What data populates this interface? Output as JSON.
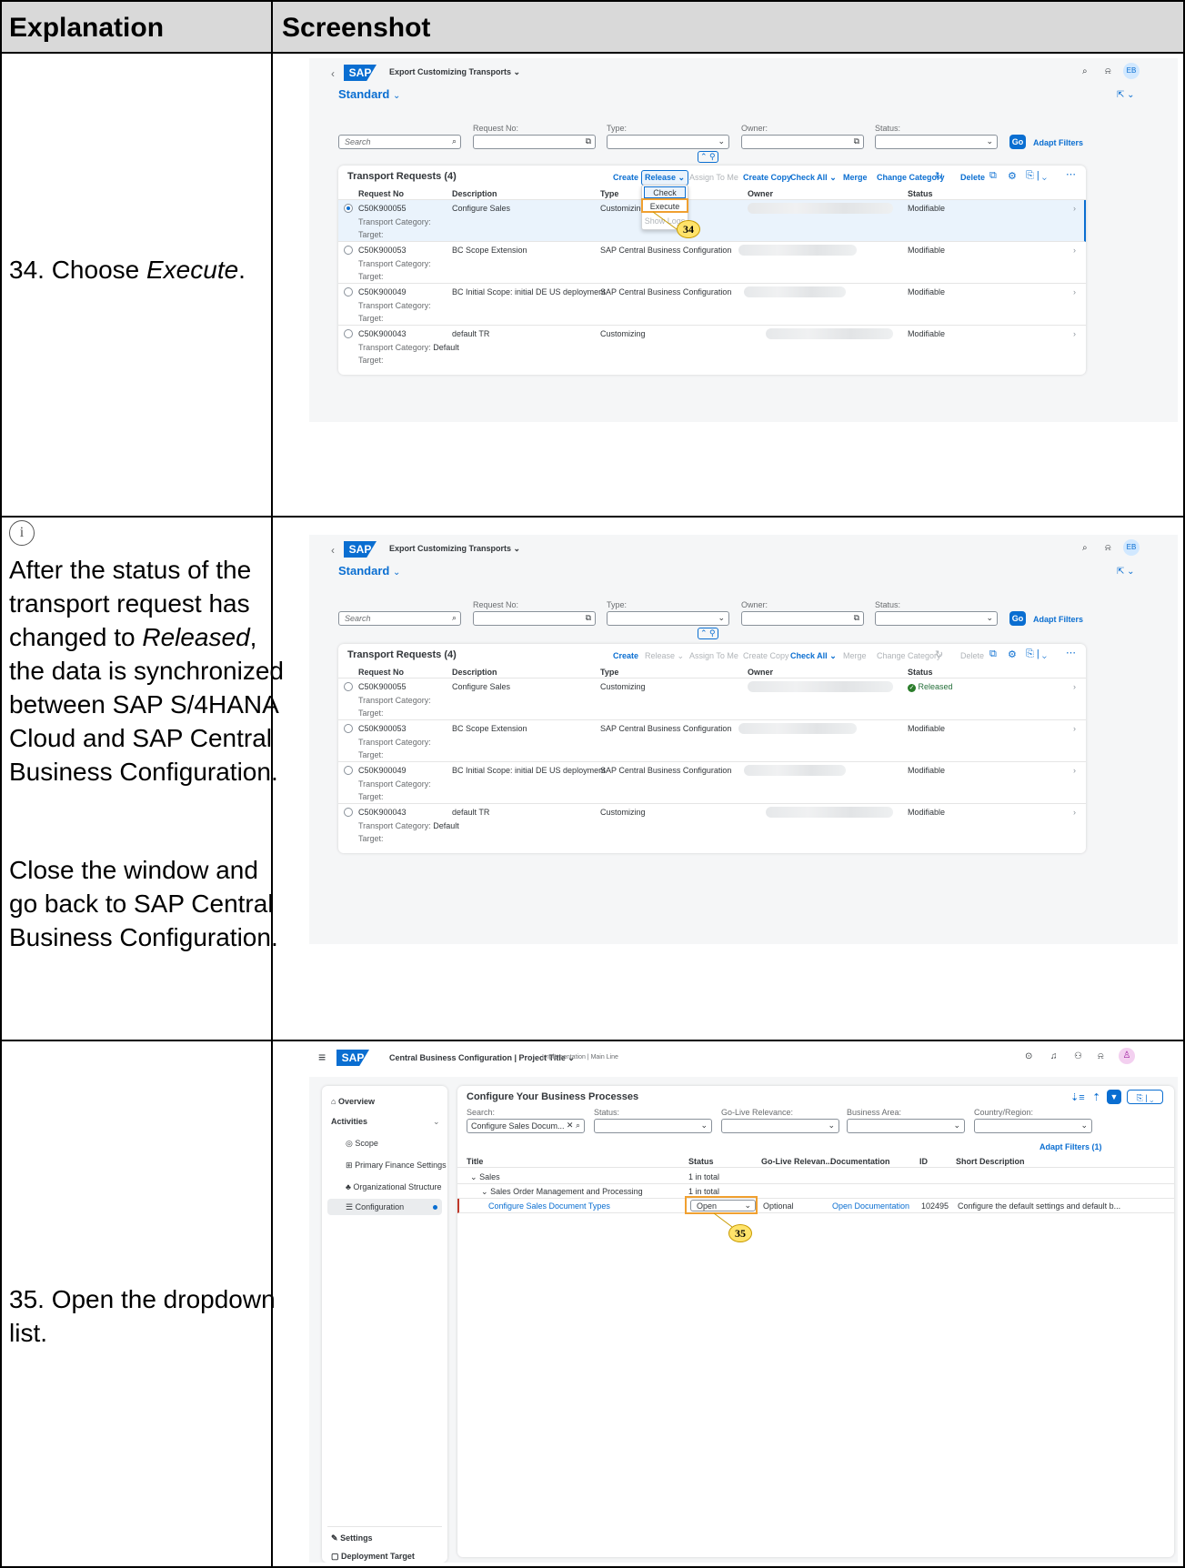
{
  "table": {
    "header_explanation": "Explanation",
    "header_screenshot": "Screenshot"
  },
  "row34": {
    "instruction_prefix": "34. Choose ",
    "instruction_italic": "Execute",
    "instruction_suffix": ".",
    "callout": "34",
    "menu": {
      "check": "Check",
      "execute": "Execute",
      "show_logs": "Show Logs"
    }
  },
  "info": {
    "icon": "info-circle-icon",
    "p1_before": "After the status of the transport request has changed to ",
    "p1_italic": "Released",
    "p1_after": ", the data is synchronized between SAP S/4HANA Cloud and SAP Central Business Configuration.",
    "p2": "Close the window and go back to SAP Central Business Configuration."
  },
  "row35": {
    "instruction": "35. Open the dropdown list.",
    "callout": "35"
  },
  "ect": {
    "app_title": "Export Customizing Transports",
    "logo": "SAP",
    "avatar": "EB",
    "variant": "Standard",
    "filters": {
      "search_placeholder": "Search",
      "request_no": "Request No:",
      "type": "Type:",
      "owner": "Owner:",
      "status": "Status:",
      "go": "Go",
      "adapt": "Adapt Filters"
    },
    "panel_title": "Transport Requests (4)",
    "toolbar": {
      "create": "Create",
      "release": "Release",
      "assign": "Assign To Me",
      "copy": "Create Copy",
      "check_all": "Check All",
      "merge": "Merge",
      "change_category": "Change Category",
      "delete": "Delete"
    },
    "cols": {
      "request_no": "Request No",
      "description": "Description",
      "type": "Type",
      "owner": "Owner",
      "status": "Status"
    },
    "labels": {
      "category": "Transport Category:",
      "target": "Target:"
    },
    "rows": [
      {
        "no": "C50K900055",
        "desc": "Configure Sales",
        "type": "Customizing",
        "status": "Modifiable",
        "category": ""
      },
      {
        "no": "C50K900053",
        "desc": "BC Scope Extension",
        "type": "SAP Central Business Configuration",
        "status": "Modifiable",
        "category": ""
      },
      {
        "no": "C50K900049",
        "desc": "BC Initial Scope: initial DE US deployment",
        "type": "SAP Central Business Configuration",
        "status": "Modifiable",
        "category": ""
      },
      {
        "no": "C50K900043",
        "desc": "default TR",
        "type": "Customizing",
        "status": "Modifiable",
        "category": "Default"
      }
    ],
    "released_status": "Released"
  },
  "cbc": {
    "logo": "SAP",
    "title": "Central Business Configuration | Project Title",
    "subtitle": "Implementation | Main Line",
    "nav": {
      "overview": "Overview",
      "activities": "Activities",
      "scope": "Scope",
      "finance": "Primary Finance Settings",
      "org": "Organizational Structure",
      "config": "Configuration",
      "settings": "Settings",
      "deployment": "Deployment Target"
    },
    "panel_title": "Configure Your Business Processes",
    "filters": {
      "search": "Search:",
      "search_value": "Configure Sales Docum...",
      "status": "Status:",
      "golive": "Go-Live Relevance:",
      "area": "Business Area:",
      "country": "Country/Region:",
      "adapt": "Adapt Filters (1)"
    },
    "cols": {
      "title": "Title",
      "status": "Status",
      "golive": "Go-Live Relevan...",
      "doc": "Documentation",
      "id": "ID",
      "short": "Short Description"
    },
    "rows": [
      {
        "title": "Sales",
        "status": "1 in total"
      },
      {
        "title": "Sales Order Management and Processing",
        "status": "1 in total"
      },
      {
        "title": "Configure Sales Document Types",
        "status": "Open",
        "golive": "Optional",
        "doc": "Open Documentation",
        "id": "102495",
        "short": "Configure the default settings and default b..."
      }
    ]
  }
}
